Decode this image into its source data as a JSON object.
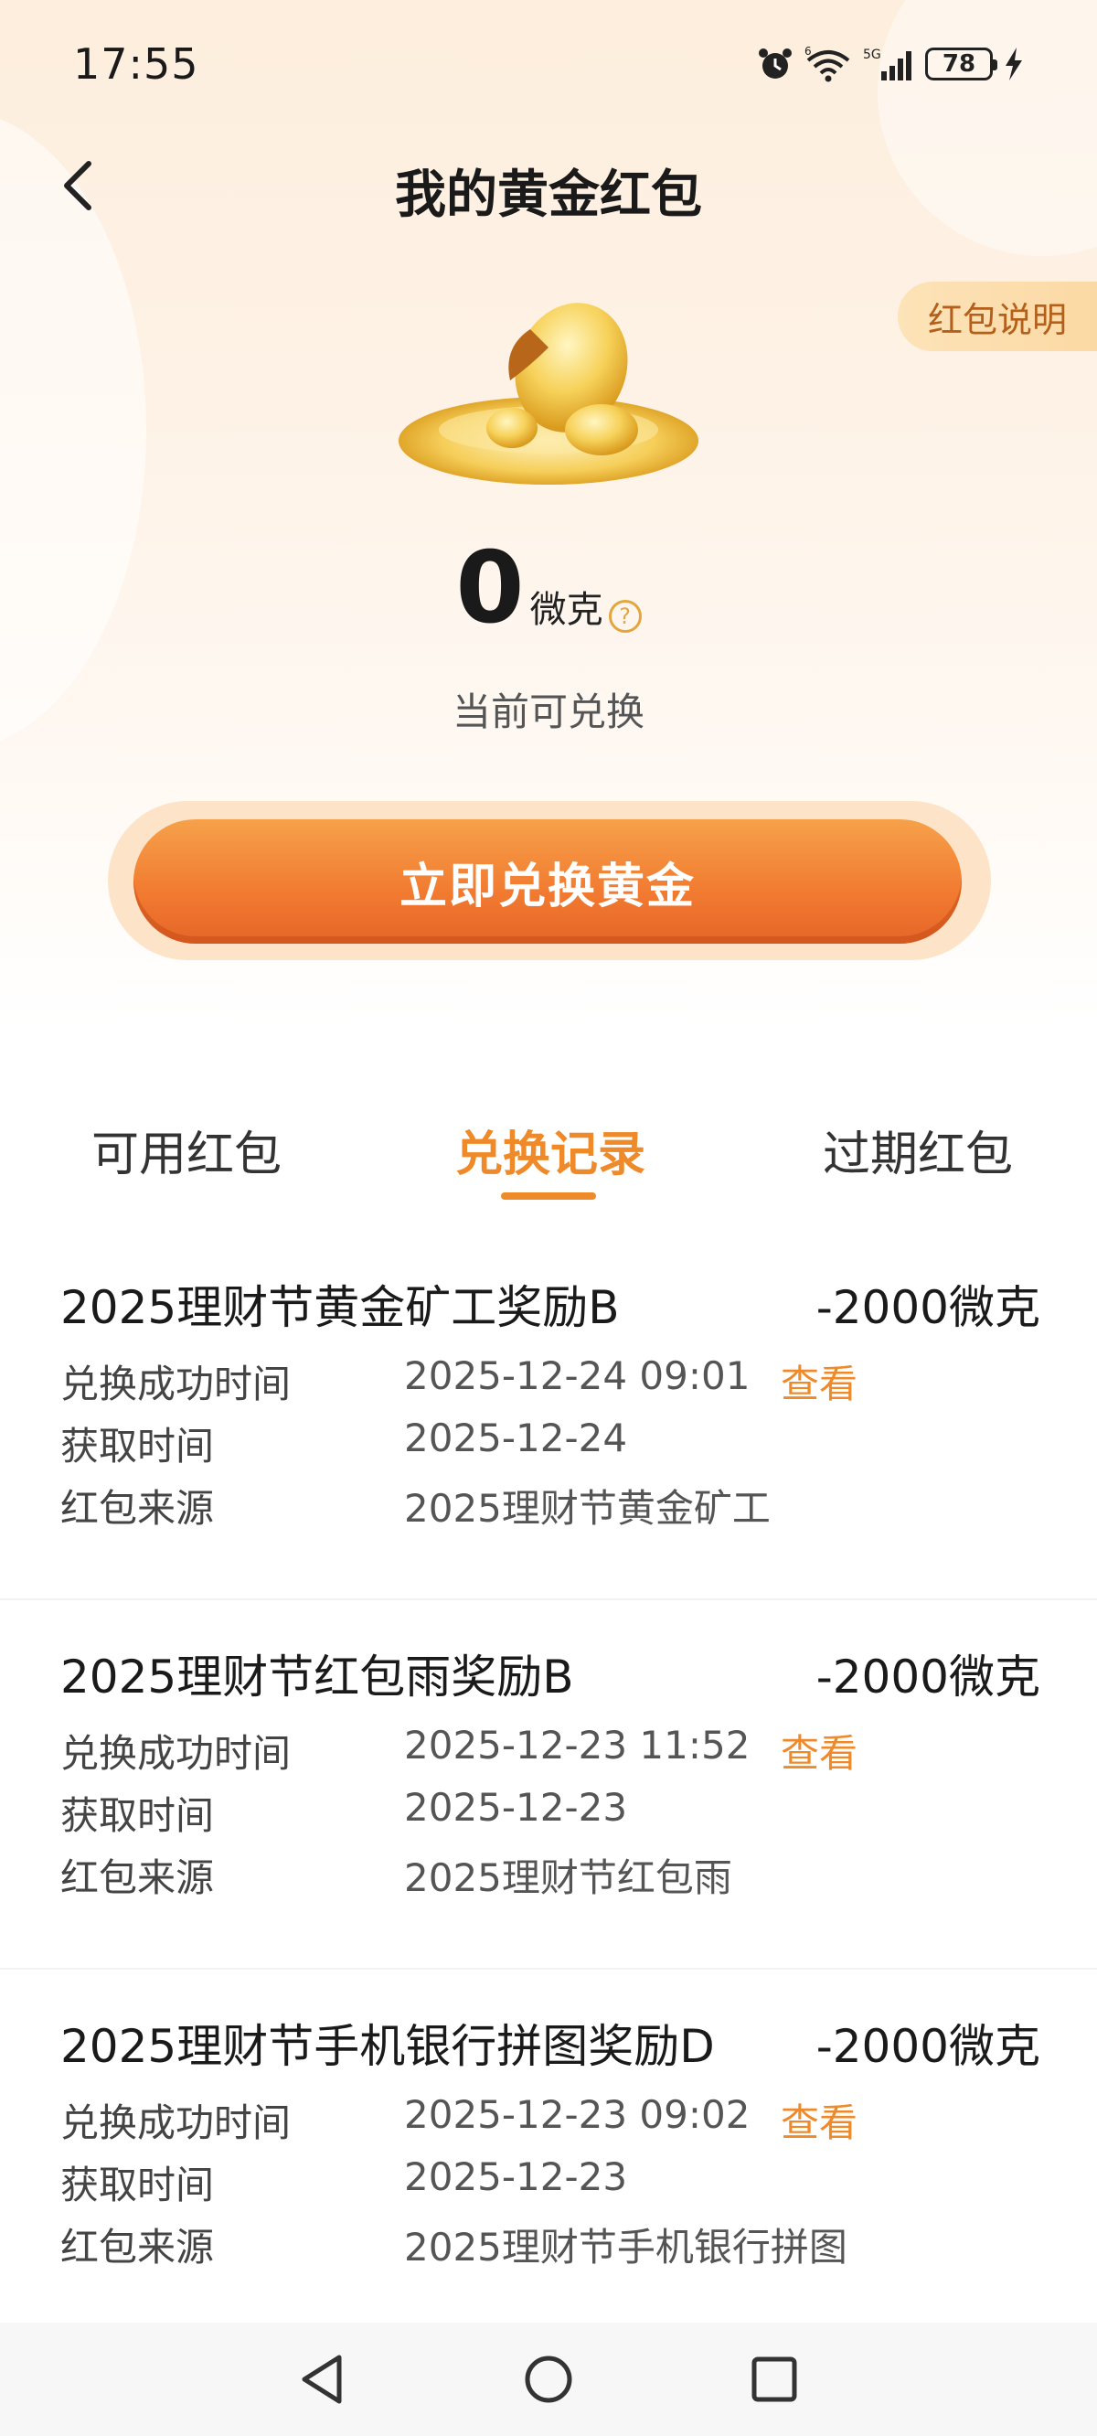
{
  "status": {
    "time": "17:55",
    "battery": "78",
    "wifi_label": "6",
    "cell_label": "5G"
  },
  "header": {
    "title": "我的黄金红包",
    "help_label": "红包说明"
  },
  "balance": {
    "amount": "0",
    "unit": "微克",
    "subtitle": "当前可兑换"
  },
  "cta": {
    "label": "立即兑换黄金"
  },
  "tabs": [
    {
      "label": "可用红包",
      "active": false
    },
    {
      "label": "兑换记录",
      "active": true
    },
    {
      "label": "过期红包",
      "active": false
    }
  ],
  "records": [
    {
      "title": "2025理财节黄金矿工奖励B",
      "amount": "-2000微克",
      "rows": [
        {
          "label": "兑换成功时间",
          "value": "2025-12-24 09:01",
          "link": "查看"
        },
        {
          "label": "获取时间",
          "value": "2025-12-24"
        },
        {
          "label": "红包来源",
          "value": "2025理财节黄金矿工"
        }
      ]
    },
    {
      "title": "2025理财节红包雨奖励B",
      "amount": "-2000微克",
      "rows": [
        {
          "label": "兑换成功时间",
          "value": "2025-12-23 11:52",
          "link": "查看"
        },
        {
          "label": "获取时间",
          "value": "2025-12-23"
        },
        {
          "label": "红包来源",
          "value": "2025理财节红包雨"
        }
      ]
    },
    {
      "title": "2025理财节手机银行拼图奖励D",
      "amount": "-2000微克",
      "rows": [
        {
          "label": "兑换成功时间",
          "value": "2025-12-23 09:02",
          "link": "查看"
        },
        {
          "label": "获取时间",
          "value": "2025-12-23"
        },
        {
          "label": "红包来源",
          "value": "2025理财节手机银行拼图"
        }
      ]
    }
  ],
  "system_nav": {
    "icons": [
      "back-triangle-icon",
      "home-circle-icon",
      "recents-square-icon"
    ]
  },
  "colors": {
    "accent": "#ef8a2a",
    "cta_top": "#f6a14a",
    "cta_bottom": "#e66528"
  }
}
